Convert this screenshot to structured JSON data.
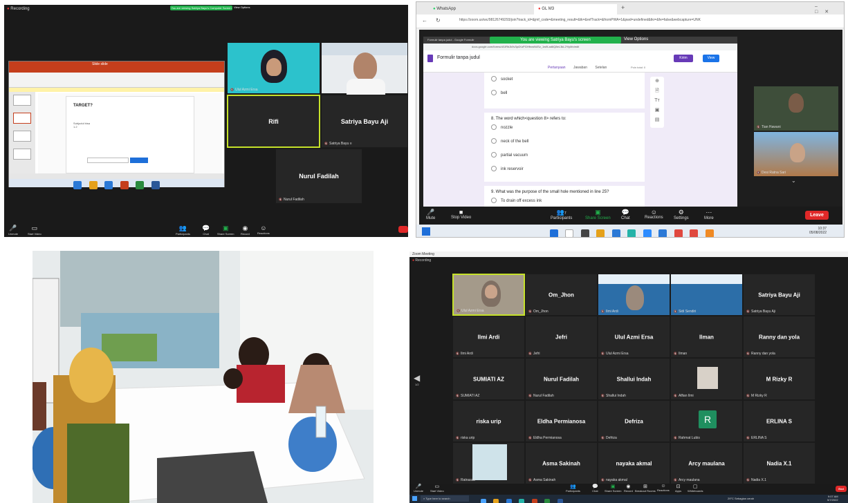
{
  "panel1": {
    "recording": "Recording",
    "viewing_banner": "You are viewing Satriya Bayu's Computer Screen",
    "view_options": "View Options",
    "ppt_title": "Slide slide",
    "slide_heading": "TARGET?",
    "slide_body": "Subjudul bisa\n1.2",
    "tiles": [
      {
        "name": "",
        "tag": "Ulul Azmi Ersa"
      },
      {
        "name": "",
        "tag": ""
      },
      {
        "name": "Rifi",
        "tag": ""
      },
      {
        "name": "Satriya Bayu Aji",
        "tag": "Satriya Bayu ≡"
      },
      {
        "name": "Nurul Fadilah",
        "tag": "Nurul Fadilah"
      }
    ],
    "controls": {
      "unmute": "Unmute",
      "start_video": "Start Video",
      "participants": "Participants",
      "chat": "Chat",
      "share_screen": "Share Screen",
      "record": "Record",
      "reactions": "Reactions"
    }
  },
  "panel2": {
    "tabs": [
      {
        "label": "WhatsApp"
      },
      {
        "label": "GL M3"
      }
    ],
    "url": "https://zoom.us/wc/98126749293/join?track_id=&jmf_code=&meeting_result=&tk=&refTrack=&fromPWA=1&pwd=undefined&tkr=&fe=false&webcapture=UNK",
    "inner_tab": "Formulir tanpa judul - Google Formulir",
    "viewing_banner": "You are viewing Satriya Bayu's screen",
    "view_options": "View Options",
    "inner_url": "docs.google.com/forms/d/1IRbJk9v3p4XoPGHfrxwN4Sz_1w9Lad6Q8eL3kL2YiyMn/edit",
    "form_title": "Formulir tanpa judul",
    "form_tabs": [
      "Pertanyaan",
      "Jawaban",
      "Setelan"
    ],
    "points": "Poin total: 0",
    "send_button": "Kirim",
    "view_button": "View",
    "options_a": [
      "socket",
      "bell"
    ],
    "question_8": "8. The word which<question 8> refers to:",
    "options_8": [
      "nozzle",
      "neck of the bell",
      "partial vacuum",
      "ink reservoir"
    ],
    "question_9": "9. What was the purpose of the small hole mentioned in line 25?",
    "options_9": [
      "To drain off excess ink"
    ],
    "participants": [
      "Tian Hawani",
      "Desi Ratna Sari"
    ],
    "controls": {
      "mute": "Mute",
      "stop_video": "Stop Video",
      "participants": "Participants",
      "participants_count": "7",
      "share_screen": "Share Screen",
      "chat": "Chat",
      "reactions": "Reactions",
      "settings": "Settings",
      "more": "More",
      "leave": "Leave"
    },
    "clock_time": "10:37",
    "clock_date": "05/08/2022"
  },
  "panel4": {
    "app_title": "Zoom Meeting",
    "recording": "Recording",
    "tiles": [
      {
        "name": "",
        "tag": "Ulul Azmi Ersa"
      },
      {
        "name": "Om_Jhon",
        "tag": "Om_Jhon"
      },
      {
        "name": "",
        "tag": "Ilmi Ardi"
      },
      {
        "name": "",
        "tag": "Sidi Sendiri"
      },
      {
        "name": "Satriya Bayu Aji",
        "tag": "Satriya Bayu Aji"
      },
      {
        "name": "Ilmi Ardi",
        "tag": "Ilmi Ardi"
      },
      {
        "name": "Jefri",
        "tag": "Jefri"
      },
      {
        "name": "Ulul Azmi Ersa",
        "tag": "Ulul Azmi Ersa"
      },
      {
        "name": "Ilman",
        "tag": "Ilman"
      },
      {
        "name": "Ranny dan yola",
        "tag": "Ranny dan yola"
      },
      {
        "name": "SUMIATI AZ",
        "tag": "SUMIATI AZ"
      },
      {
        "name": "Nurul Fadilah",
        "tag": "Nurul Fadilah"
      },
      {
        "name": "Shallui Indah",
        "tag": "Shallui Indah"
      },
      {
        "name": "",
        "tag": "Alfian Ilmi"
      },
      {
        "name": "M Rizky R",
        "tag": "M Rizky R"
      },
      {
        "name": "riska urip",
        "tag": "riska urip"
      },
      {
        "name": "Eldha Permianosa",
        "tag": "Eldha Permianosa"
      },
      {
        "name": "Defriza",
        "tag": "Defriza"
      },
      {
        "name": "R",
        "tag": "Rahmat Lubis"
      },
      {
        "name": "ERLINA S",
        "tag": "ERLINA S"
      },
      {
        "name": "",
        "tag": "Ratnasari"
      },
      {
        "name": "Asma Sakinah",
        "tag": "Asma Sakinah"
      },
      {
        "name": "nayaka akmal",
        "tag": "nayaka akmal"
      },
      {
        "name": "Arcy maulana",
        "tag": "Arcy maulana"
      },
      {
        "name": "Nadia X.1",
        "tag": "Nadia X.1"
      }
    ],
    "page_indicator": "1/2",
    "controls": {
      "unmute": "Unmute",
      "start_video": "Start Video",
      "participants": "Participants",
      "chat": "Chat",
      "share_screen": "Share Screen",
      "record": "Record",
      "breakout": "Breakout Rooms",
      "reactions": "Reactions",
      "apps": "Apps",
      "whiteboards": "Whiteboards",
      "end": "End"
    },
    "search_placeholder": "Type here to search",
    "weather": "29°C Sebagian cerah",
    "clock_time": "9:07 AM",
    "clock_date": "5/7/2022"
  }
}
